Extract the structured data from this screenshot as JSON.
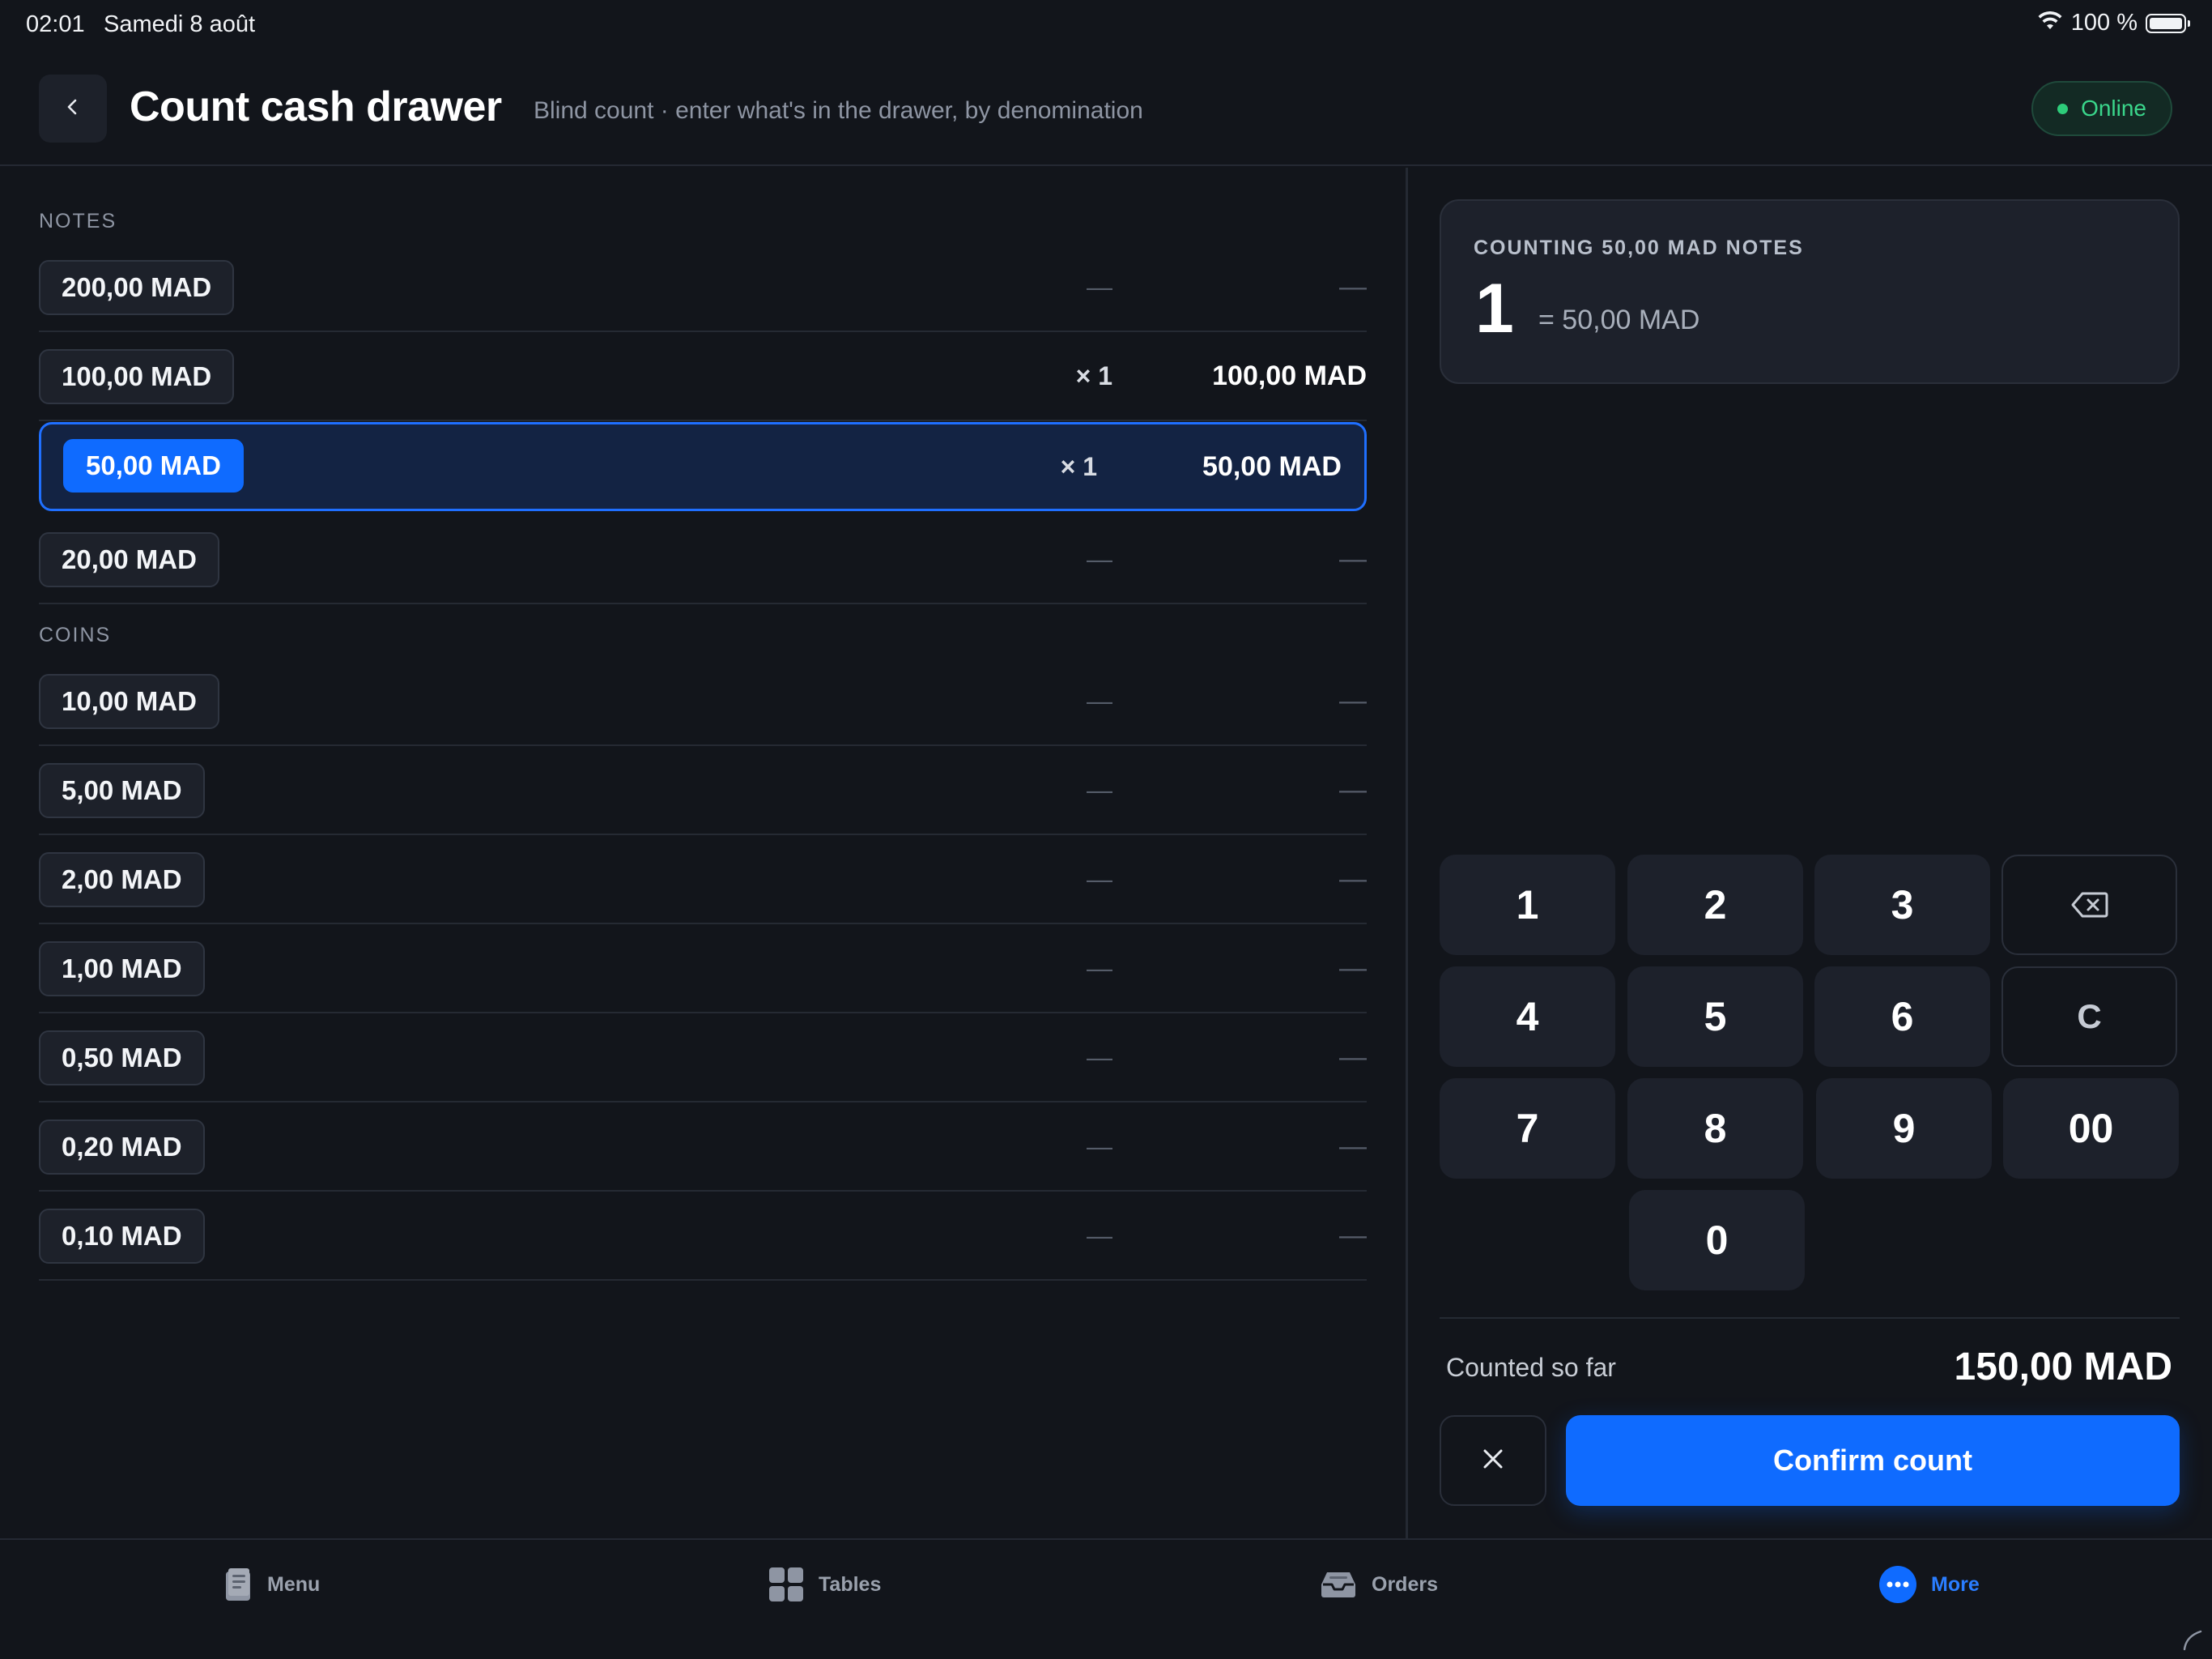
{
  "status_bar": {
    "time": "02:01",
    "date": "Samedi 8 août",
    "battery": "100 %"
  },
  "header": {
    "title": "Count cash drawer",
    "subtitle": "Blind count · enter what's in the drawer, by denomination",
    "status": "Online"
  },
  "notes": {
    "label": "NOTES",
    "rows": [
      {
        "denomination": "200,00 MAD",
        "qty": "—",
        "total": "—"
      },
      {
        "denomination": "100,00 MAD",
        "qty": "× 1",
        "total": "100,00 MAD"
      },
      {
        "denomination": "50,00 MAD",
        "qty": "× 1",
        "total": "50,00 MAD"
      },
      {
        "denomination": "20,00 MAD",
        "qty": "—",
        "total": "—"
      }
    ]
  },
  "coins": {
    "label": "COINS",
    "rows": [
      {
        "denomination": "10,00 MAD",
        "qty": "—",
        "total": "—"
      },
      {
        "denomination": "5,00 MAD",
        "qty": "—",
        "total": "—"
      },
      {
        "denomination": "2,00 MAD",
        "qty": "—",
        "total": "—"
      },
      {
        "denomination": "1,00 MAD",
        "qty": "—",
        "total": "—"
      },
      {
        "denomination": "0,50 MAD",
        "qty": "—",
        "total": "—"
      },
      {
        "denomination": "0,20 MAD",
        "qty": "—",
        "total": "—"
      },
      {
        "denomination": "0,10 MAD",
        "qty": "—",
        "total": "—"
      }
    ]
  },
  "counter": {
    "label": "COUNTING 50,00 MAD NOTES",
    "value": "1",
    "equals": "= 50,00 MAD"
  },
  "keypad": {
    "keys": [
      "1",
      "2",
      "3",
      "4",
      "5",
      "6",
      "7",
      "8",
      "9",
      "00",
      "0"
    ],
    "clear": "C",
    "backspace_icon": "backspace-icon"
  },
  "summary": {
    "label": "Counted so far",
    "value": "150,00 MAD"
  },
  "actions": {
    "confirm": "Confirm count",
    "cancel_icon": "close-icon"
  },
  "tabbar": {
    "items": [
      {
        "label": "Menu",
        "icon": "menu-book-icon"
      },
      {
        "label": "Tables",
        "icon": "tables-grid-icon"
      },
      {
        "label": "Orders",
        "icon": "orders-tray-icon"
      },
      {
        "label": "More",
        "icon": "more-dots-icon"
      }
    ],
    "active": "More"
  },
  "colors": {
    "background": "#12151b",
    "accent": "#0f6bff",
    "online": "#2ecc7a",
    "card": "#1d212b"
  }
}
